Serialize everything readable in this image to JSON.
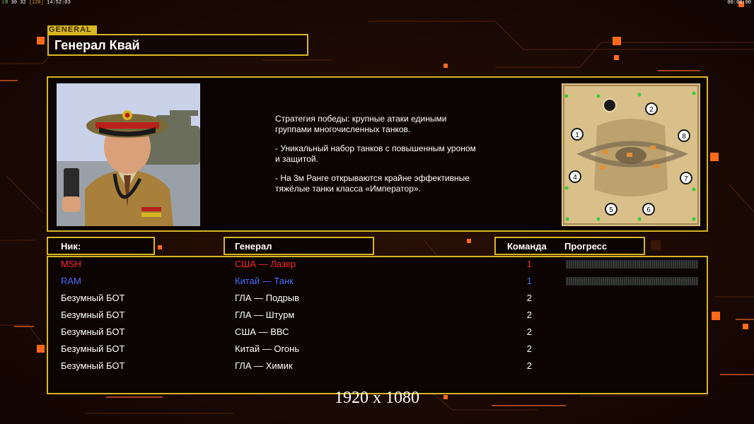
{
  "hud": {
    "fps_prefix": "LR",
    "fps_values": "30 32",
    "fps_bracket": "[120]",
    "time_left": "14:52:03",
    "time_right": "00:00:00"
  },
  "general": {
    "tag": "GENERAL",
    "name": "Генерал Квай"
  },
  "description": [
    "Стратегия победы: крупные атаки едиными\n группами многочисленных танков.",
    "- Уникальный набор танков с повышенным уроном\n и защитой.",
    "- На 3м Ранге открываются крайне эффективные\n тяжёлые танки класса «Император»."
  ],
  "headers": {
    "nick": "Ник:",
    "general": "Генерал",
    "team": "Команда",
    "progress": "Прогресс"
  },
  "players": [
    {
      "nick": "MSH",
      "general": "США — Лазер",
      "team": "1",
      "color": "#ff2a2a",
      "show_progress": true
    },
    {
      "nick": "RAM",
      "general": "Китай — Танк",
      "team": "1",
      "color": "#4a6cff",
      "show_progress": true
    },
    {
      "nick": "Безумный БОТ",
      "general": "ГЛА — Подрыв",
      "team": "2",
      "color": "#ffffff",
      "show_progress": false
    },
    {
      "nick": "Безумный БОТ",
      "general": "ГЛА — Штурм",
      "team": "2",
      "color": "#ffffff",
      "show_progress": false
    },
    {
      "nick": "Безумный БОТ",
      "general": "США — ВВС",
      "team": "2",
      "color": "#ffffff",
      "show_progress": false
    },
    {
      "nick": "Безумный БОТ",
      "general": "Китай — Огонь",
      "team": "2",
      "color": "#ffffff",
      "show_progress": false
    },
    {
      "nick": "Безумный БОТ",
      "general": "ГЛА — Химик",
      "team": "2",
      "color": "#ffffff",
      "show_progress": false
    }
  ],
  "map": {
    "start_positions": [
      "1",
      "2",
      "4",
      "5",
      "6",
      "7",
      "8"
    ]
  },
  "resolution_label": "1920 x 1080",
  "colors": {
    "accent": "#d8b623",
    "orange": "#ff6a1a",
    "bg": "#1c0a03"
  }
}
